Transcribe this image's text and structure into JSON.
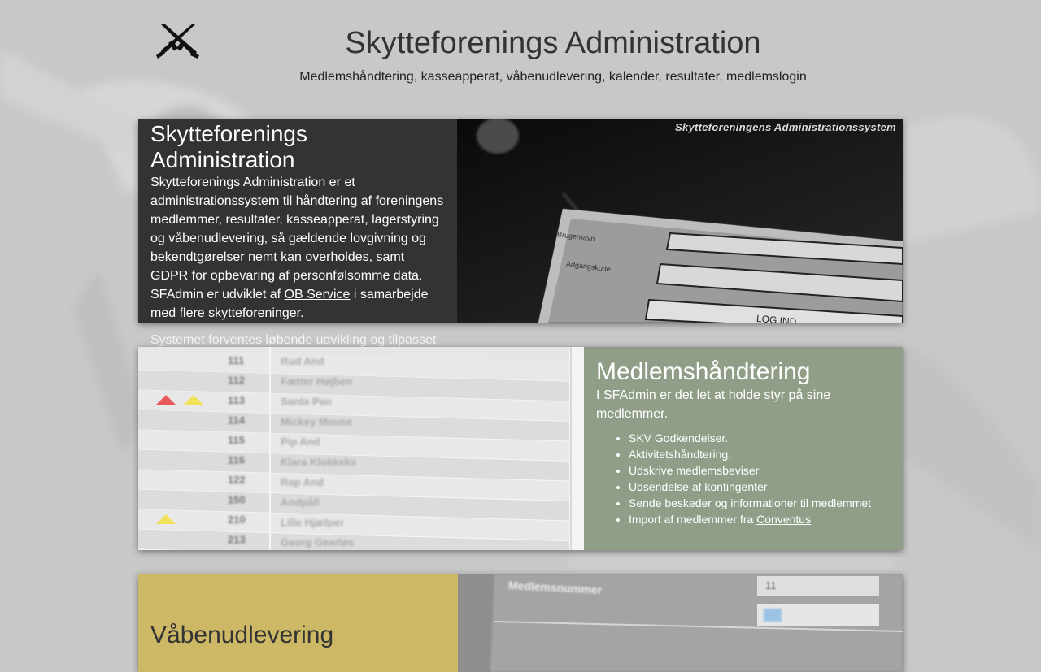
{
  "header": {
    "title": "Skytteforenings Administration",
    "subtitle": "Medlemshåndtering, kasseapperat, våbenudlevering, kalender, resultater, medlemslogin",
    "logo_icon": "rifles-icon"
  },
  "intro": {
    "heading": "Skytteforenings Administration",
    "body_before_link": "Skytteforenings Administration er et administrationssystem til håndtering af foreningens medlemmer, resultater, kasseapperat, lagerstyring og våbenudlevering, så gældende lovgivning og bekendtgørelser nemt kan overholdes, samt GDPR for opbevaring af personfølsomme data. SFAdmin er udviklet af ",
    "link_text": "OB Service",
    "body_after_link": " i samarbejde med flere skytteforeninger.",
    "overflow_text": "Systemet forventes løbende udvikling og tilpasset",
    "screenshot": {
      "caption": "Skytteforeningens Administrationssystem",
      "username_label": "Brugernavn",
      "password_label": "Adgangskode",
      "login_button": "LOG IND"
    }
  },
  "members": {
    "heading": "Medlemshåndtering",
    "intro": "I SFAdmin er det let at holde styr på sine medlemmer.",
    "features": [
      "SKV Godkendelser.",
      "Aktivitetshåndtering.",
      "Udskrive medlemsbeviser",
      "Udsendelse af kontingenter",
      "Sende beskeder og informationer til medlemmet"
    ],
    "import_prefix": "Import af medlemmer fra ",
    "import_link": "Conventus",
    "table_rows": [
      {
        "num": "111",
        "name": "Rud And",
        "warn": ""
      },
      {
        "num": "112",
        "name": "Fætter Højben",
        "warn": ""
      },
      {
        "num": "113",
        "name": "Santa Pan",
        "warn": "both"
      },
      {
        "num": "114",
        "name": "Mickey Mouse",
        "warn": ""
      },
      {
        "num": "115",
        "name": "Pip And",
        "warn": ""
      },
      {
        "num": "116",
        "name": "Klara Klokkeks",
        "warn": ""
      },
      {
        "num": "122",
        "name": "Rap And",
        "warn": ""
      },
      {
        "num": "150",
        "name": "Andpåll",
        "warn": ""
      },
      {
        "num": "210",
        "name": "Lille Hjælper",
        "warn": "yellow"
      },
      {
        "num": "213",
        "name": "Georg Gearløs",
        "warn": ""
      }
    ],
    "colors": {
      "danger": "#e8595c",
      "warning": "#f2e15a"
    }
  },
  "weapons": {
    "heading": "Våbenudlevering",
    "screenshot": {
      "field_label": "Medlemsnummer",
      "field_value": "11"
    }
  }
}
